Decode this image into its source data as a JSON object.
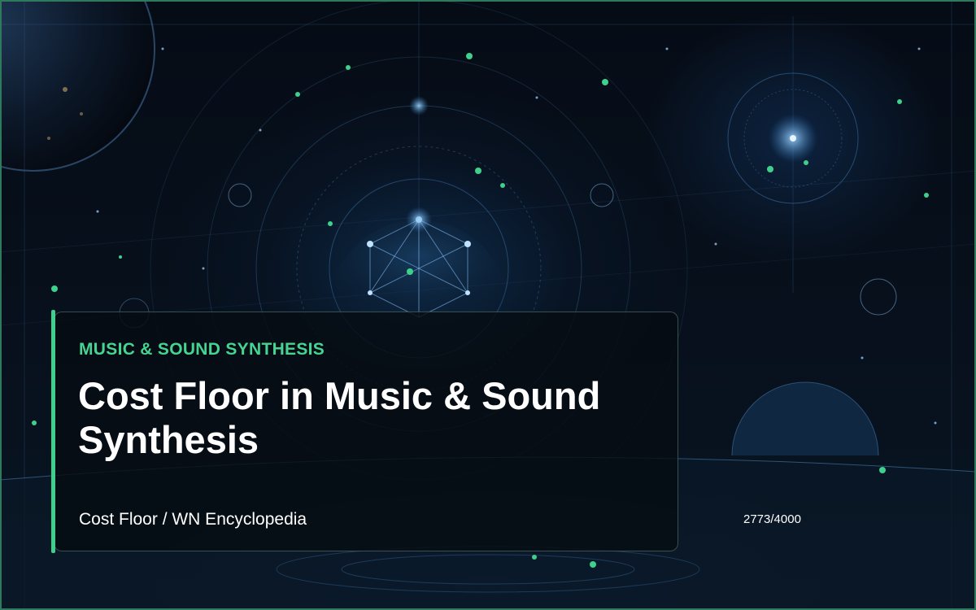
{
  "header": {
    "category": "MUSIC & SOUND SYNTHESIS",
    "title": "Cost Floor in Music & Sound Synthesis"
  },
  "footer": {
    "source": "Cost Floor / WN Encyclopedia",
    "counter": "2773/4000"
  },
  "colors": {
    "accent": "#3fd08b",
    "category_text": "#47d391",
    "frame": "#2f7a5c",
    "background": "#050a12"
  }
}
